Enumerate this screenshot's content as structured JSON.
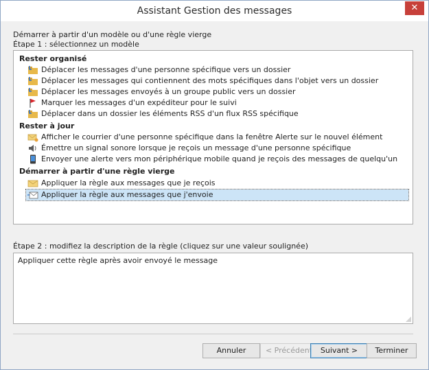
{
  "window": {
    "title": "Assistant Gestion des messages",
    "close_glyph": "✕"
  },
  "intro": {
    "start_label": "Démarrer à partir d'un modèle ou d'une règle vierge",
    "step1_label": "Étape 1 : sélectionnez un modèle"
  },
  "groups": [
    {
      "header": "Rester organisé",
      "items": [
        {
          "label": "Déplacer les messages d'une personne spécifique vers un dossier",
          "icon": "folder-move-icon"
        },
        {
          "label": "Déplacer les messages qui contiennent des mots spécifiques dans l'objet vers un dossier",
          "icon": "folder-move-icon"
        },
        {
          "label": "Déplacer les messages envoyés à un groupe public vers un dossier",
          "icon": "folder-move-icon"
        },
        {
          "label": "Marquer les messages d'un expéditeur pour le suivi",
          "icon": "red-flag-icon"
        },
        {
          "label": "Déplacer dans un dossier les éléments RSS d'un flux RSS spécifique",
          "icon": "folder-move-icon"
        }
      ]
    },
    {
      "header": "Rester à jour",
      "items": [
        {
          "label": "Afficher le courrier d'une personne spécifique dans la fenêtre Alerte sur le nouvel élément",
          "icon": "mail-alert-icon"
        },
        {
          "label": "Émettre un signal sonore lorsque je reçois un message d'une personne spécifique",
          "icon": "speaker-icon"
        },
        {
          "label": "Envoyer une alerte vers mon périphérique mobile quand je reçois des messages de quelqu'un",
          "icon": "mobile-phone-icon"
        }
      ]
    },
    {
      "header": "Démarrer à partir d'une règle vierge",
      "items": [
        {
          "label": "Appliquer la règle aux messages que je reçois",
          "icon": "envelope-icon"
        },
        {
          "label": "Appliquer la règle aux messages que j'envoie",
          "icon": "send-mail-icon",
          "selected": true
        }
      ]
    }
  ],
  "step2": {
    "label": "Étape 2 : modifiez la description de la règle (cliquez sur une valeur soulignée)",
    "description": "Appliquer cette règle après avoir envoyé le message"
  },
  "buttons": {
    "cancel": "Annuler",
    "previous": "< Précédent",
    "next": "Suivant >",
    "finish": "Terminer"
  },
  "colors": {
    "selection": "#cce4f7",
    "close_button": "#c7403a",
    "folder": "#e8b94a",
    "flag": "#d9262b"
  }
}
